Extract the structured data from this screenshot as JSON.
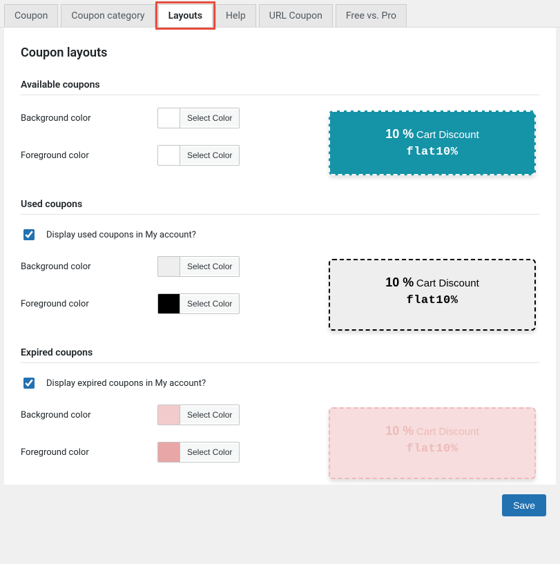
{
  "tabs": {
    "coupon": "Coupon",
    "coupon_category": "Coupon category",
    "layouts": "Layouts",
    "help": "Help",
    "url_coupon": "URL Coupon",
    "free_vs_pro": "Free vs. Pro"
  },
  "page_title": "Coupon layouts",
  "select_color_label": "Select Color",
  "sections": {
    "available": {
      "heading": "Available coupons",
      "bg_label": "Background color",
      "fg_label": "Foreground color",
      "bg_color": "#1593a7",
      "fg_color": "#ffffff"
    },
    "used": {
      "heading": "Used coupons",
      "checkbox_label": "Display used coupons in My account?",
      "bg_label": "Background color",
      "fg_label": "Foreground color",
      "bg_color": "#eeeeee",
      "fg_color": "#000000"
    },
    "expired": {
      "heading": "Expired coupons",
      "checkbox_label": "Display expired coupons in My account?",
      "bg_label": "Background color",
      "fg_label": "Foreground color",
      "bg_color": "#f2cccc",
      "fg_color": "#e8a6a6"
    }
  },
  "preview": {
    "percent": "10 %",
    "desc": "Cart Discount",
    "code": "flat10%"
  },
  "save_label": "Save"
}
